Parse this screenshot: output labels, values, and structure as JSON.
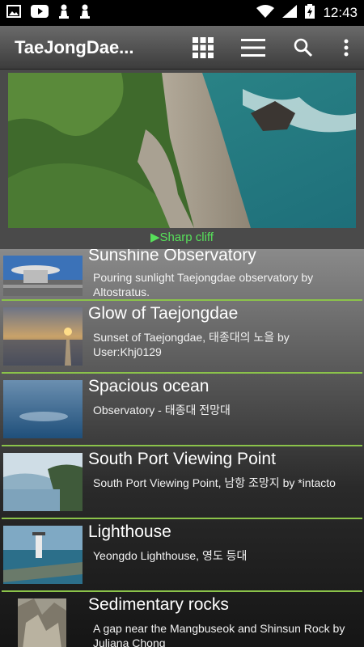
{
  "status": {
    "time": "12:43"
  },
  "app": {
    "title": "TaeJongDae..."
  },
  "hero": {
    "caption": "Sharp cliff"
  },
  "items": [
    {
      "name": "Sunshine Observatory",
      "desc": "Pouring sunlight Taejongdae observatory by Altostratus."
    },
    {
      "name": "Glow of Taejongdae",
      "desc": "Sunset of Taejongdae, 태종대의 노을 by User:Khj0129"
    },
    {
      "name": "Spacious ocean",
      "desc": "Observatory - 태종대 전망대"
    },
    {
      "name": "South Port Viewing Point",
      "desc": "South Port Viewing Point, 남항 조망지 by *intacto"
    },
    {
      "name": "Lighthouse",
      "desc": "Yeongdo Lighthouse, 영도 등대"
    },
    {
      "name": "Sedimentary rocks",
      "desc": "A gap near the Mangbuseok and Shinsun Rock by Juliana Chong"
    }
  ],
  "colors": {
    "accent": "#8bc34a",
    "caption": "#57e05a"
  }
}
